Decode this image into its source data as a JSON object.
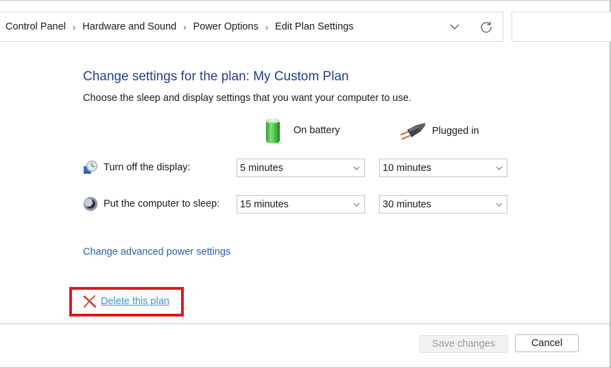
{
  "address_bar": {
    "breadcrumbs": [
      "Control Panel",
      "Hardware and Sound",
      "Power Options",
      "Edit Plan Settings"
    ],
    "dropdown_icon": "chevron-down-icon",
    "refresh_icon": "refresh-icon"
  },
  "search": {
    "placeholder": ""
  },
  "main": {
    "title": "Change settings for the plan: My Custom Plan",
    "subtitle": "Choose the sleep and display settings that you want your computer to use.",
    "columns": {
      "battery": {
        "label": "On battery",
        "icon": "battery-icon"
      },
      "plugged": {
        "label": "Plugged in",
        "icon": "power-plug-icon"
      }
    },
    "rows": [
      {
        "label": "Turn off the display:",
        "icon": "display-clock-icon",
        "battery": "5 minutes",
        "plugged": "10 minutes"
      },
      {
        "label": "Put the computer to sleep:",
        "icon": "sleep-moon-icon",
        "battery": "15 minutes",
        "plugged": "30 minutes"
      }
    ],
    "advanced_link": "Change advanced power settings",
    "delete_link": "Delete this plan",
    "highlight_color": "#e3141c",
    "title_color": "#1e3f8f",
    "link_color": "#1e62b0"
  },
  "footer": {
    "save_label": "Save changes",
    "save_enabled": false,
    "cancel_label": "Cancel"
  }
}
